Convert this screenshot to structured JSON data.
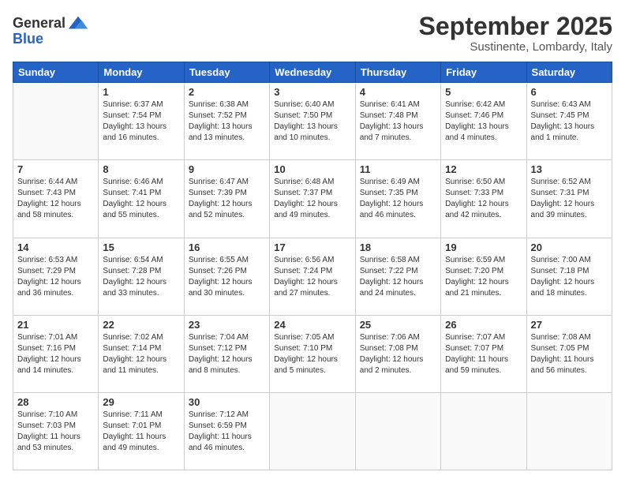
{
  "logo": {
    "general": "General",
    "blue": "Blue"
  },
  "header": {
    "month": "September 2025",
    "location": "Sustinente, Lombardy, Italy"
  },
  "weekdays": [
    "Sunday",
    "Monday",
    "Tuesday",
    "Wednesday",
    "Thursday",
    "Friday",
    "Saturday"
  ],
  "weeks": [
    [
      {
        "day": "",
        "info": ""
      },
      {
        "day": "1",
        "info": "Sunrise: 6:37 AM\nSunset: 7:54 PM\nDaylight: 13 hours\nand 16 minutes."
      },
      {
        "day": "2",
        "info": "Sunrise: 6:38 AM\nSunset: 7:52 PM\nDaylight: 13 hours\nand 13 minutes."
      },
      {
        "day": "3",
        "info": "Sunrise: 6:40 AM\nSunset: 7:50 PM\nDaylight: 13 hours\nand 10 minutes."
      },
      {
        "day": "4",
        "info": "Sunrise: 6:41 AM\nSunset: 7:48 PM\nDaylight: 13 hours\nand 7 minutes."
      },
      {
        "day": "5",
        "info": "Sunrise: 6:42 AM\nSunset: 7:46 PM\nDaylight: 13 hours\nand 4 minutes."
      },
      {
        "day": "6",
        "info": "Sunrise: 6:43 AM\nSunset: 7:45 PM\nDaylight: 13 hours\nand 1 minute."
      }
    ],
    [
      {
        "day": "7",
        "info": "Sunrise: 6:44 AM\nSunset: 7:43 PM\nDaylight: 12 hours\nand 58 minutes."
      },
      {
        "day": "8",
        "info": "Sunrise: 6:46 AM\nSunset: 7:41 PM\nDaylight: 12 hours\nand 55 minutes."
      },
      {
        "day": "9",
        "info": "Sunrise: 6:47 AM\nSunset: 7:39 PM\nDaylight: 12 hours\nand 52 minutes."
      },
      {
        "day": "10",
        "info": "Sunrise: 6:48 AM\nSunset: 7:37 PM\nDaylight: 12 hours\nand 49 minutes."
      },
      {
        "day": "11",
        "info": "Sunrise: 6:49 AM\nSunset: 7:35 PM\nDaylight: 12 hours\nand 46 minutes."
      },
      {
        "day": "12",
        "info": "Sunrise: 6:50 AM\nSunset: 7:33 PM\nDaylight: 12 hours\nand 42 minutes."
      },
      {
        "day": "13",
        "info": "Sunrise: 6:52 AM\nSunset: 7:31 PM\nDaylight: 12 hours\nand 39 minutes."
      }
    ],
    [
      {
        "day": "14",
        "info": "Sunrise: 6:53 AM\nSunset: 7:29 PM\nDaylight: 12 hours\nand 36 minutes."
      },
      {
        "day": "15",
        "info": "Sunrise: 6:54 AM\nSunset: 7:28 PM\nDaylight: 12 hours\nand 33 minutes."
      },
      {
        "day": "16",
        "info": "Sunrise: 6:55 AM\nSunset: 7:26 PM\nDaylight: 12 hours\nand 30 minutes."
      },
      {
        "day": "17",
        "info": "Sunrise: 6:56 AM\nSunset: 7:24 PM\nDaylight: 12 hours\nand 27 minutes."
      },
      {
        "day": "18",
        "info": "Sunrise: 6:58 AM\nSunset: 7:22 PM\nDaylight: 12 hours\nand 24 minutes."
      },
      {
        "day": "19",
        "info": "Sunrise: 6:59 AM\nSunset: 7:20 PM\nDaylight: 12 hours\nand 21 minutes."
      },
      {
        "day": "20",
        "info": "Sunrise: 7:00 AM\nSunset: 7:18 PM\nDaylight: 12 hours\nand 18 minutes."
      }
    ],
    [
      {
        "day": "21",
        "info": "Sunrise: 7:01 AM\nSunset: 7:16 PM\nDaylight: 12 hours\nand 14 minutes."
      },
      {
        "day": "22",
        "info": "Sunrise: 7:02 AM\nSunset: 7:14 PM\nDaylight: 12 hours\nand 11 minutes."
      },
      {
        "day": "23",
        "info": "Sunrise: 7:04 AM\nSunset: 7:12 PM\nDaylight: 12 hours\nand 8 minutes."
      },
      {
        "day": "24",
        "info": "Sunrise: 7:05 AM\nSunset: 7:10 PM\nDaylight: 12 hours\nand 5 minutes."
      },
      {
        "day": "25",
        "info": "Sunrise: 7:06 AM\nSunset: 7:08 PM\nDaylight: 12 hours\nand 2 minutes."
      },
      {
        "day": "26",
        "info": "Sunrise: 7:07 AM\nSunset: 7:07 PM\nDaylight: 11 hours\nand 59 minutes."
      },
      {
        "day": "27",
        "info": "Sunrise: 7:08 AM\nSunset: 7:05 PM\nDaylight: 11 hours\nand 56 minutes."
      }
    ],
    [
      {
        "day": "28",
        "info": "Sunrise: 7:10 AM\nSunset: 7:03 PM\nDaylight: 11 hours\nand 53 minutes."
      },
      {
        "day": "29",
        "info": "Sunrise: 7:11 AM\nSunset: 7:01 PM\nDaylight: 11 hours\nand 49 minutes."
      },
      {
        "day": "30",
        "info": "Sunrise: 7:12 AM\nSunset: 6:59 PM\nDaylight: 11 hours\nand 46 minutes."
      },
      {
        "day": "",
        "info": ""
      },
      {
        "day": "",
        "info": ""
      },
      {
        "day": "",
        "info": ""
      },
      {
        "day": "",
        "info": ""
      }
    ]
  ]
}
